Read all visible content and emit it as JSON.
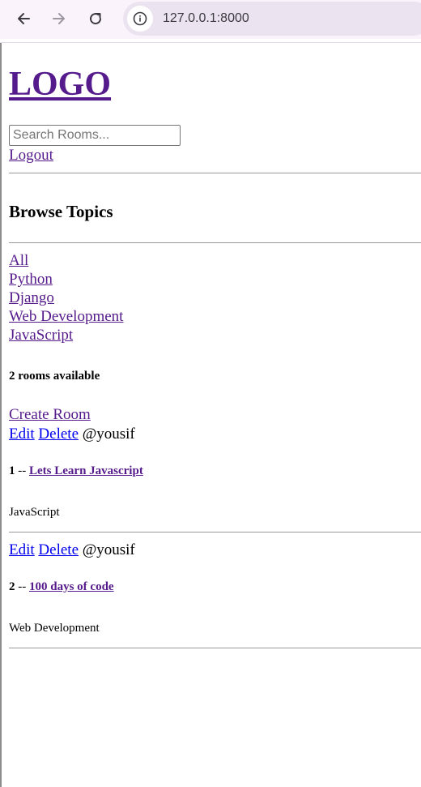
{
  "browser": {
    "url": "127.0.0.1:8000"
  },
  "header": {
    "logo": "LOGO",
    "search_placeholder": "Search Rooms...",
    "logout": "Logout"
  },
  "topics": {
    "title": "Browse Topics",
    "items": [
      "All",
      "Python",
      "Django",
      "Web Development",
      "JavaScript"
    ]
  },
  "rooms": {
    "count_text": "2 rooms available",
    "create_label": "Create Room",
    "list": [
      {
        "edit_label": "Edit",
        "delete_label": "Delete",
        "host": "@yousif",
        "id": "1",
        "separator": "--",
        "name": "Lets Learn Javascript",
        "topic": "JavaScript"
      },
      {
        "edit_label": "Edit",
        "delete_label": "Delete",
        "host": "@yousif",
        "id": "2",
        "separator": "--",
        "name": "100 days of code",
        "topic": "Web Development"
      }
    ]
  },
  "icons": {
    "back": "back-arrow-icon",
    "forward": "forward-arrow-icon",
    "reload": "reload-icon",
    "site_info": "info-icon"
  },
  "colors": {
    "visited_link": "#551a8b",
    "unvisited_link": "#0000ee",
    "chrome_bg": "#fbf3fc",
    "urlbar_bg": "#ebe3ef"
  }
}
